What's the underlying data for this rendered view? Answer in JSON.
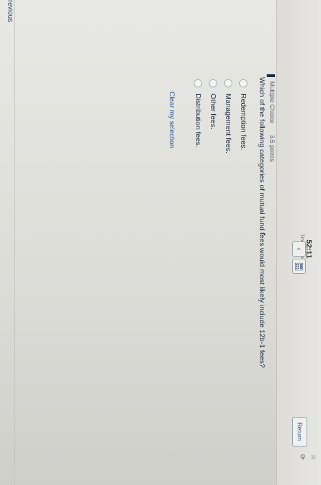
{
  "header": {
    "timer": "52:11",
    "timer_label": "Time Remaining",
    "back_icon": "chevron-left-icon",
    "calculator_icon": "calculator-icon",
    "return_label": "Return"
  },
  "question": {
    "type": "Multiple Choice",
    "points": "3.5 points",
    "text": "Which of the following categories of mutual fund fees would most likely include 12b-1 fees?",
    "options": [
      "Redemption fees.",
      "Management fees.",
      "Other fees.",
      "Distribution fees."
    ],
    "clear_label": "Clear my selection"
  },
  "footer": {
    "previous_label": "revious"
  }
}
